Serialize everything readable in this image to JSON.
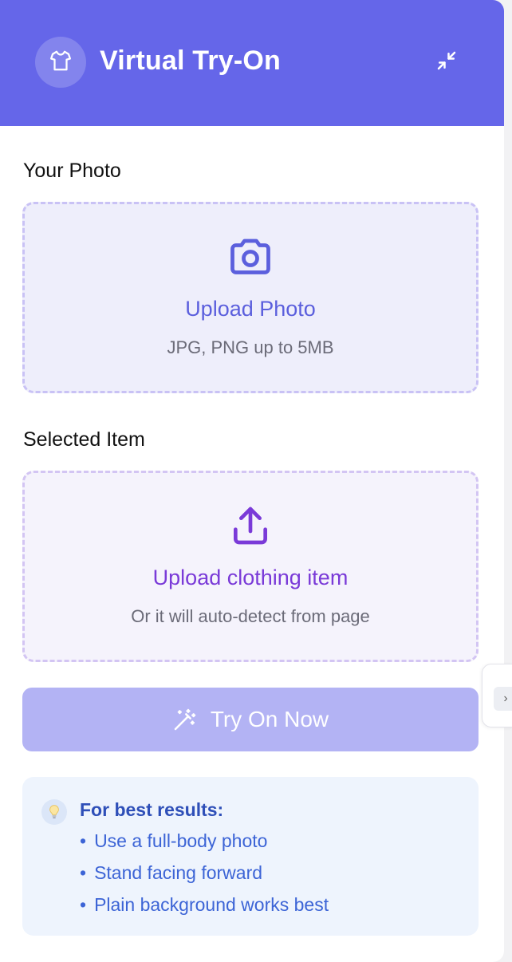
{
  "header": {
    "title": "Virtual Try-On",
    "logo_icon": "tshirt-icon",
    "collapse_icon": "minimize-icon",
    "background": "#6566e9"
  },
  "photo_section": {
    "label": "Your Photo",
    "upload_label": "Upload Photo",
    "hint": "JPG, PNG up to 5MB",
    "icon": "camera-icon"
  },
  "item_section": {
    "label": "Selected Item",
    "upload_label": "Upload clothing item",
    "hint": "Or it will auto-detect from page",
    "icon": "upload-icon"
  },
  "try_button": {
    "label": "Try On Now",
    "icon": "magic-wand-icon",
    "color": "#b3b3f4"
  },
  "tips": {
    "icon": "lightbulb-icon",
    "title": "For best results:",
    "items": [
      "Use a full-body photo",
      "Stand facing forward",
      "Plain background works best"
    ]
  },
  "side_handle": {
    "icon": "chevron-right-icon",
    "glyph": "›"
  }
}
